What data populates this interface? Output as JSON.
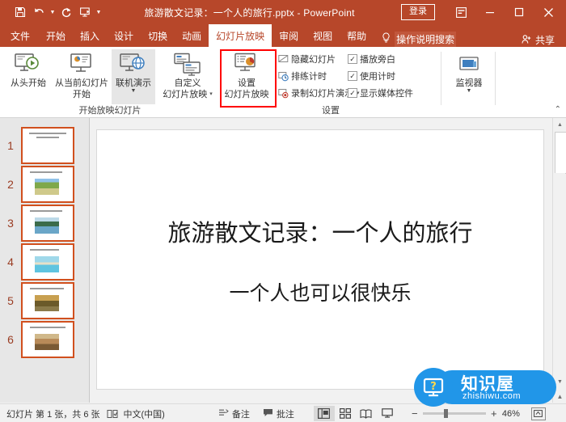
{
  "titlebar": {
    "document_title": "旅游散文记录：一个人的旅行.pptx  -  PowerPoint",
    "signin_label": "登录",
    "qat": [
      {
        "name": "save-icon",
        "tooltip": "保存"
      },
      {
        "name": "undo-icon",
        "tooltip": "撤销"
      },
      {
        "name": "redo-icon",
        "tooltip": "重复"
      },
      {
        "name": "start-from-beginning-icon",
        "tooltip": "从头开始"
      },
      {
        "name": "customize-qat-icon",
        "tooltip": "自定义快速访问工具栏"
      }
    ],
    "window_buttons": [
      {
        "name": "ribbon-display-options-icon"
      },
      {
        "name": "minimize-icon"
      },
      {
        "name": "maximize-icon"
      },
      {
        "name": "close-icon"
      }
    ],
    "background_color": "#b7472a"
  },
  "tabs": [
    {
      "label": "文件",
      "active": false
    },
    {
      "label": "开始",
      "active": false
    },
    {
      "label": "插入",
      "active": false
    },
    {
      "label": "设计",
      "active": false
    },
    {
      "label": "切换",
      "active": false
    },
    {
      "label": "动画",
      "active": false
    },
    {
      "label": "幻灯片放映",
      "active": true
    },
    {
      "label": "审阅",
      "active": false
    },
    {
      "label": "视图",
      "active": false
    },
    {
      "label": "帮助",
      "active": false
    }
  ],
  "tellme": {
    "label": "操作说明搜索",
    "icon": "lightbulb-icon"
  },
  "share": {
    "label": "共享",
    "icon": "share-person-icon"
  },
  "ribbon": {
    "groups": [
      {
        "name": "start-slideshow",
        "label": "开始放映幻灯片",
        "buttons": [
          {
            "label_line1": "从头开始",
            "label_line2": "",
            "icon": "slideshow-play-icon",
            "selected": false,
            "has_caret": false
          },
          {
            "label_line1": "从当前幻灯片",
            "label_line2": "开始",
            "icon": "slideshow-current-icon",
            "selected": false,
            "has_caret": false
          },
          {
            "label_line1": "联机演示",
            "label_line2": "",
            "icon": "present-online-icon",
            "selected": true,
            "has_caret": true
          },
          {
            "label_line1": "自定义",
            "label_line2": "幻灯片放映",
            "icon": "custom-show-icon",
            "selected": false,
            "has_caret": true
          }
        ]
      },
      {
        "name": "setup",
        "label": "设置",
        "buttons": [
          {
            "label_line1": "设置",
            "label_line2": "幻灯片放映",
            "icon": "setup-show-icon",
            "selected": false,
            "has_caret": false,
            "highlighted": true
          }
        ],
        "small_commands": [
          {
            "label": "隐藏幻灯片",
            "icon": "hide-slide-icon"
          },
          {
            "label": "排练计时",
            "icon": "rehearse-timing-icon"
          },
          {
            "label": "录制幻灯片演示",
            "icon": "record-slideshow-icon",
            "has_caret": true
          }
        ],
        "checkboxes": [
          {
            "label": "播放旁白",
            "checked": true
          },
          {
            "label": "使用计时",
            "checked": true
          },
          {
            "label": "显示媒体控件",
            "checked": true
          }
        ]
      },
      {
        "name": "monitors",
        "label": "",
        "buttons": [
          {
            "label_line1": "监视器",
            "label_line2": "",
            "icon": "monitor-icon",
            "selected": false,
            "has_caret": true
          }
        ]
      }
    ],
    "collapse_icon": "chevron-up-icon",
    "highlight_color": "#ff0000"
  },
  "thumbnails": {
    "selected_index": 1,
    "border_color": "#d1501e",
    "items": [
      {
        "number": "1",
        "has_image": false,
        "image_colors": []
      },
      {
        "number": "2",
        "has_image": true,
        "image_colors": [
          "#7fa84a",
          "#2e6b1f",
          "#cfc98a"
        ]
      },
      {
        "number": "3",
        "has_image": true,
        "image_colors": [
          "#6aa6c8",
          "#3b6b4a",
          "#d7d2b4"
        ]
      },
      {
        "number": "4",
        "has_image": true,
        "image_colors": [
          "#5fc4e0",
          "#2f86a8",
          "#e6e0c8"
        ]
      },
      {
        "number": "5",
        "has_image": true,
        "image_colors": [
          "#c8a050",
          "#6b5a2a",
          "#8a7a4a"
        ]
      },
      {
        "number": "6",
        "has_image": true,
        "image_colors": [
          "#b88a58",
          "#7a5a34",
          "#d0b88a"
        ]
      }
    ]
  },
  "slide": {
    "title": "旅游散文记录：一个人的旅行",
    "subtitle": "一个人也可以很快乐"
  },
  "scrollbar": {
    "up_arrow_icon": "triangle-up-icon",
    "down_arrow_icon": "triangle-down-icon",
    "fit_icon": "fit-slide-icon"
  },
  "statusbar": {
    "slide_count": "幻灯片 第 1 张，共 6 张",
    "spellcheck_icon": "spellcheck-icon",
    "language": "中文(中国)",
    "notes": {
      "label": "备注",
      "icon": "notes-icon"
    },
    "comments": {
      "label": "批注",
      "icon": "comment-icon"
    },
    "views": [
      {
        "name": "normal-view",
        "icon": "normal-view-icon",
        "active": true
      },
      {
        "name": "slide-sorter-view",
        "icon": "slide-sorter-icon",
        "active": false
      },
      {
        "name": "reading-view",
        "icon": "reading-view-icon",
        "active": false
      },
      {
        "name": "slideshow-view",
        "icon": "slideshow-view-icon",
        "active": false
      }
    ],
    "zoom": {
      "minus": "−",
      "plus": "+",
      "percent": "46%",
      "fit_icon": "fit-to-window-icon"
    }
  },
  "watermark": {
    "cn_text": "知识屋",
    "en_text": "zhishiwu.com",
    "icon": "question-monitor-icon",
    "color": "#2196e8"
  }
}
